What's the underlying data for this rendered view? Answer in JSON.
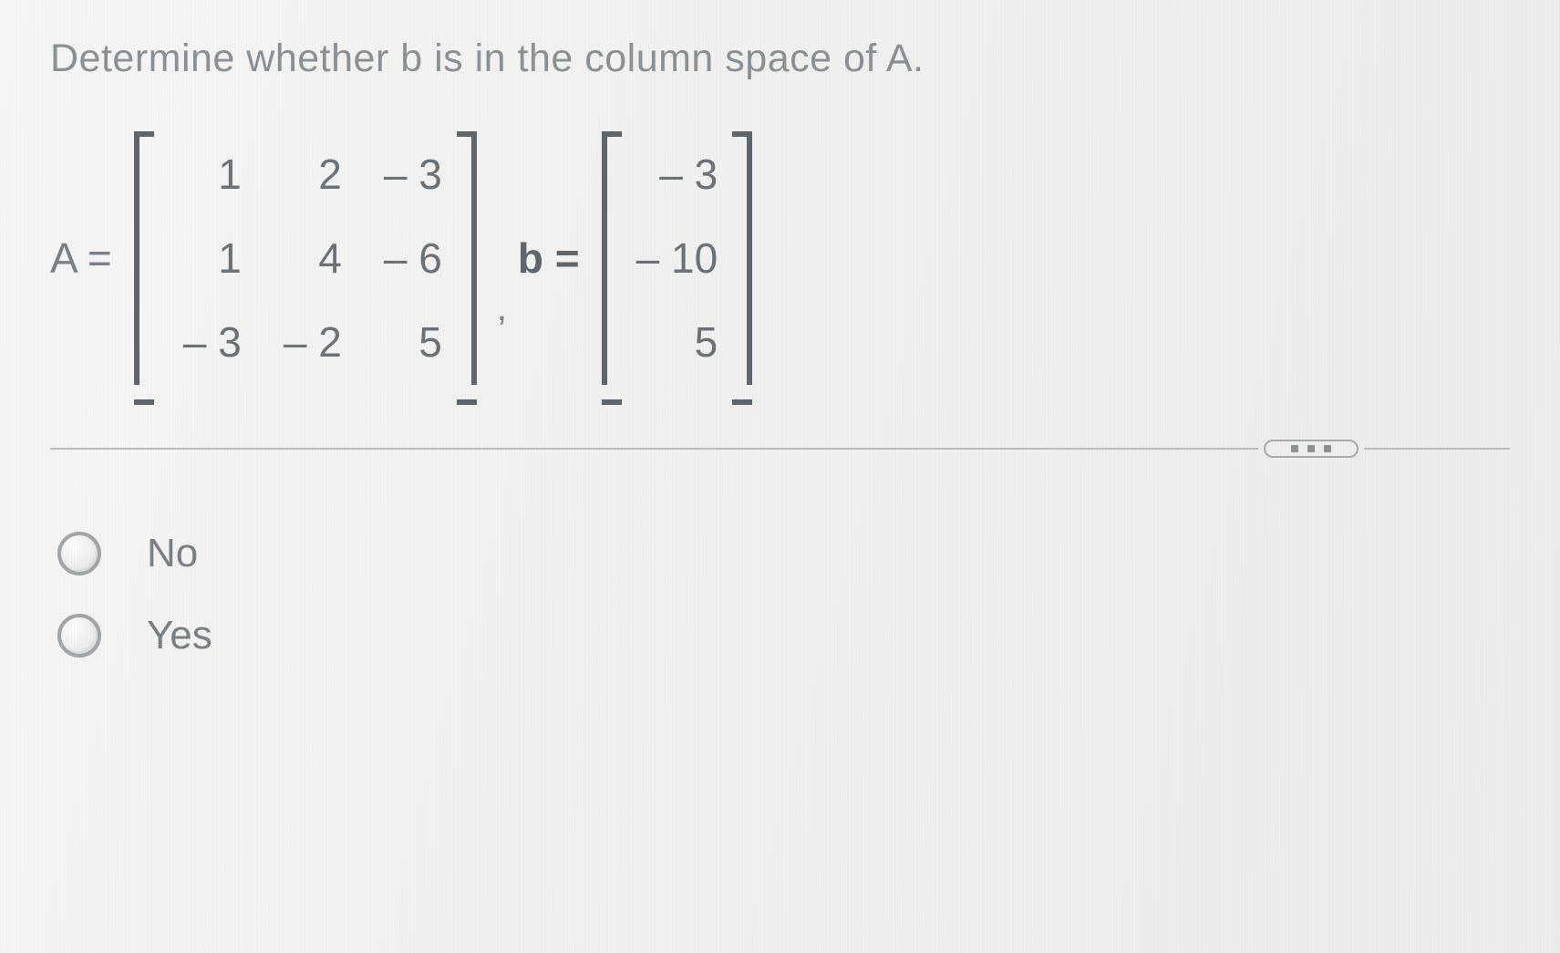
{
  "question": "Determine whether b is in the column space of A.",
  "equationA_label": "A =",
  "equationB_label": "b =",
  "comma": ",",
  "matrixA": {
    "r1c1": "1",
    "r1c2": "2",
    "r1c3": "– 3",
    "r2c1": "1",
    "r2c2": "4",
    "r2c3": "– 6",
    "r3c1": "– 3",
    "r3c2": "– 2",
    "r3c3": "5"
  },
  "vectorB": {
    "r1": "– 3",
    "r2": "– 10",
    "r3": "5"
  },
  "options": {
    "no": "No",
    "yes": "Yes"
  }
}
